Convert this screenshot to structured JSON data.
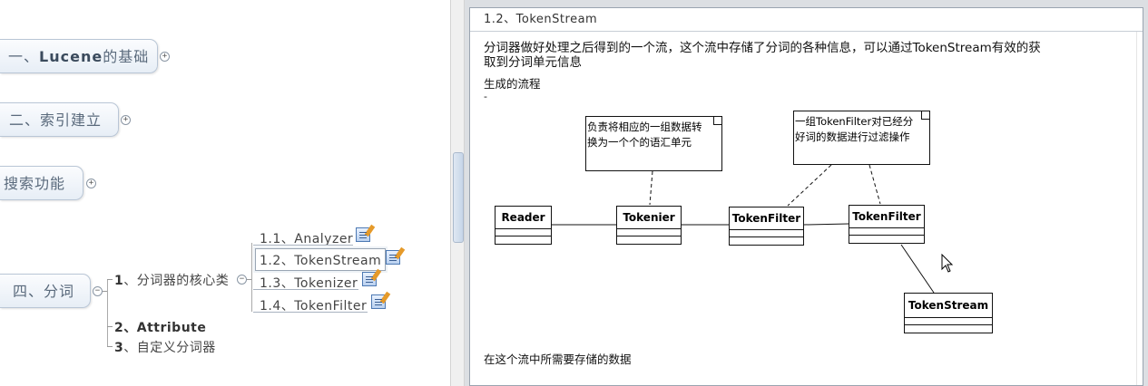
{
  "mindmap": {
    "topics": [
      {
        "prefix": "一、",
        "bold": "Lucene",
        "suffix": "的基础",
        "expander": "+"
      },
      {
        "prefix": "",
        "bold": "",
        "suffix": "二、索引建立",
        "expander": "+"
      },
      {
        "prefix": "",
        "bold": "",
        "suffix": "搜索功能",
        "expander": "+"
      },
      {
        "prefix": "",
        "bold": "",
        "suffix": "四、分词",
        "expander": "−"
      }
    ],
    "subtopics": [
      {
        "num": "1",
        "label": "、分词器的核心类",
        "bold": false,
        "expander": "−"
      },
      {
        "num": "2",
        "label": "、Attribute",
        "bold": true
      },
      {
        "num": "3",
        "label": "、自定义分词器",
        "bold": false
      }
    ],
    "leaves": [
      {
        "label": "1.1、Analyzer",
        "selected": false
      },
      {
        "label": "1.2、TokenStream",
        "selected": true
      },
      {
        "label": "1.3、Tokenizer",
        "selected": false
      },
      {
        "label": "1.4、TokenFilter",
        "selected": false
      }
    ]
  },
  "notes": {
    "title": "1.2、TokenStream",
    "paragraph_line1": "分词器做好处理之后得到的一个流，这个流中存储了分词的各种信息，可以通过TokenStream有效的获",
    "paragraph_line2": "取到分词单元信息",
    "flow_heading": "生成的流程",
    "tick": "-",
    "footer": "在这个流中所需要存储的数据",
    "diagram": {
      "classes": {
        "reader": "Reader",
        "tokenizer": "Tokenier",
        "filter1": "TokenFilter",
        "filter2": "TokenFilter",
        "stream": "TokenStream"
      },
      "note1_line1": "负责将相应的一组数据转",
      "note1_line2": "换为一个个的语汇单元",
      "note2_line1": "一组TokenFilter对已经分",
      "note2_line2": "好词的数据进行过滤操作"
    }
  },
  "colors": {
    "topic_border": "#b9c6d6",
    "topic_text": "#5a6a7c",
    "note_icon": "#4d79b3"
  }
}
